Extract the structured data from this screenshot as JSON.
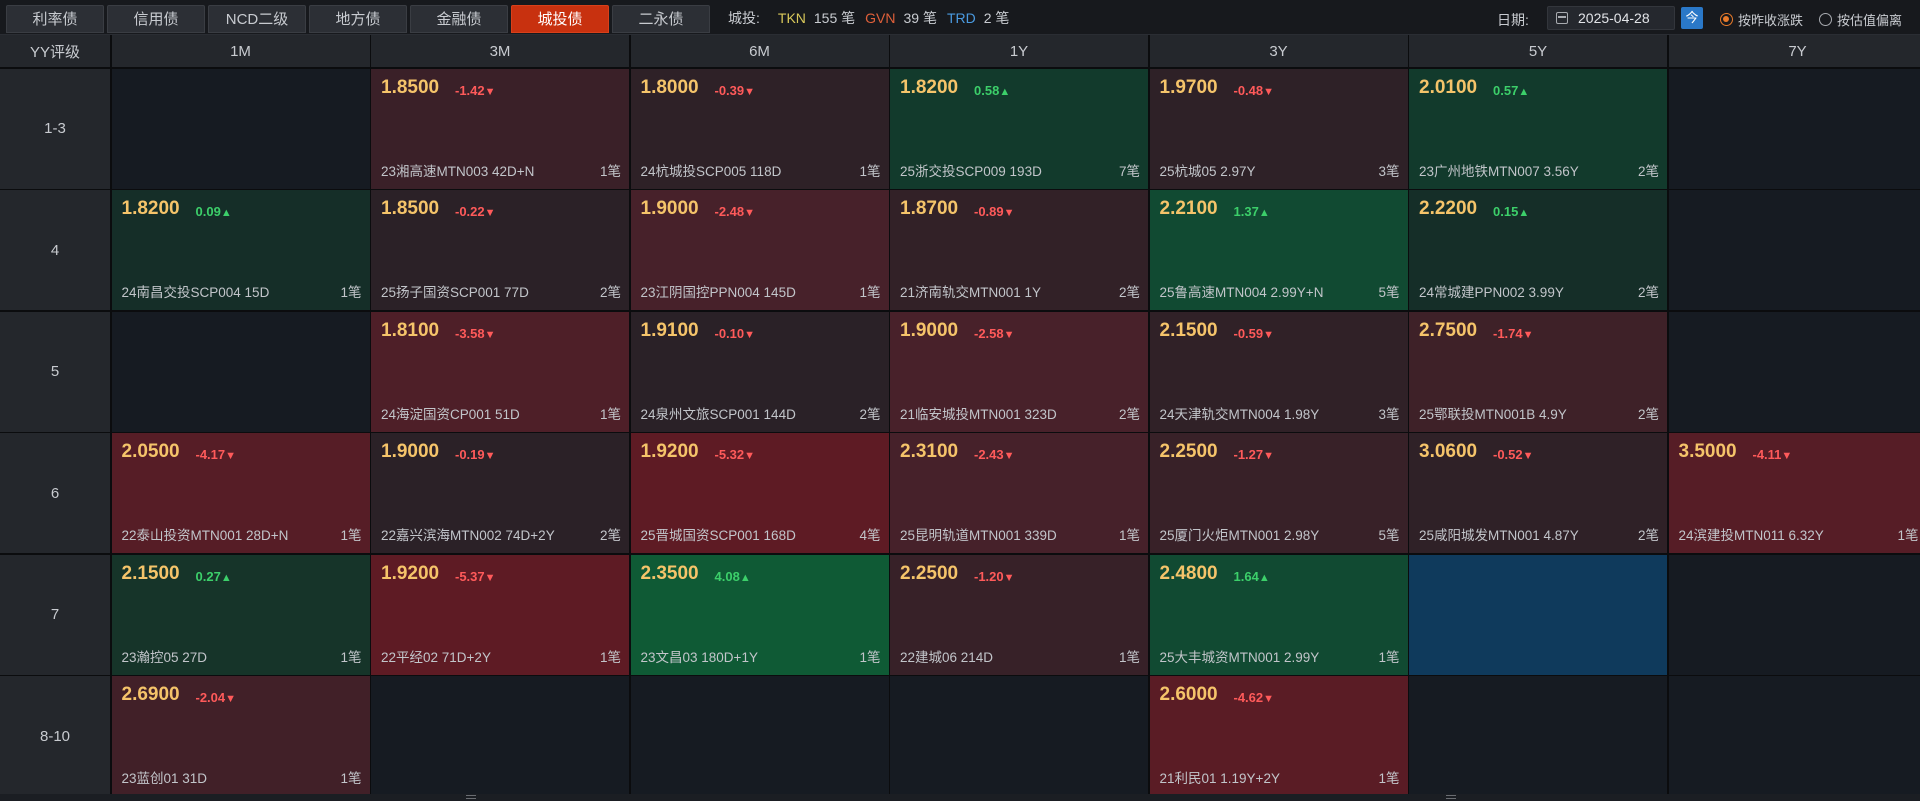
{
  "tabs": [
    "利率债",
    "信用债",
    "NCD二级",
    "地方债",
    "金融债",
    "城投债",
    "二永债"
  ],
  "active_tab": "城投债",
  "stats": {
    "label": "城投:",
    "tkn_key": "TKN",
    "tkn_value": "155 笔",
    "gvn_key": "GVN",
    "gvn_value": "39 笔",
    "trd_key": "TRD",
    "trd_value": "2 笔"
  },
  "date": {
    "label": "日期:",
    "value": "2025-04-28",
    "today_label": "今"
  },
  "radios": [
    {
      "label": "按昨收涨跌",
      "checked": true
    },
    {
      "label": "按估值偏离",
      "checked": false
    }
  ],
  "colors": {
    "active_tab": "#c8310f",
    "yield": "#f5c46a",
    "up": "#3ccf6a",
    "down": "#ff5a5a"
  },
  "grid": {
    "corner": "YY评级",
    "columns": [
      "1M",
      "3M",
      "6M",
      "1Y",
      "3Y",
      "5Y",
      "7Y"
    ],
    "rows": [
      {
        "rating": "1-3",
        "cells": [
          null,
          {
            "yield": "1.8500",
            "change": "-1.42",
            "dir": "down",
            "bond": "23湘高速MTN003 42D+N",
            "count": "1笔",
            "bg": "#3a2028"
          },
          {
            "yield": "1.8000",
            "change": "-0.39",
            "dir": "down",
            "bond": "24杭城投SCP005 118D",
            "count": "1笔",
            "bg": "#2e2127"
          },
          {
            "yield": "1.8200",
            "change": "0.58",
            "dir": "up",
            "bond": "25浙交投SCP009 193D",
            "count": "7笔",
            "bg": "#123a2c"
          },
          {
            "yield": "1.9700",
            "change": "-0.48",
            "dir": "down",
            "bond": "25杭城05 2.97Y",
            "count": "3笔",
            "bg": "#2e2127"
          },
          {
            "yield": "2.0100",
            "change": "0.57",
            "dir": "up",
            "bond": "23广州地铁MTN007 3.56Y",
            "count": "2笔",
            "bg": "#123a2c"
          },
          null
        ]
      },
      {
        "rating": "4",
        "cells": [
          {
            "yield": "1.8200",
            "change": "0.09",
            "dir": "up",
            "bond": "24南昌交投SCP004 15D",
            "count": "1笔",
            "bg": "#152e28"
          },
          {
            "yield": "1.8500",
            "change": "-0.22",
            "dir": "down",
            "bond": "25扬子国资SCP001 77D",
            "count": "2笔",
            "bg": "#2b2127"
          },
          {
            "yield": "1.9000",
            "change": "-2.48",
            "dir": "down",
            "bond": "23江阴国控PPN004 145D",
            "count": "1笔",
            "bg": "#47212a"
          },
          {
            "yield": "1.8700",
            "change": "-0.89",
            "dir": "down",
            "bond": "21济南轨交MTN001 1Y",
            "count": "2笔",
            "bg": "#322127"
          },
          {
            "yield": "2.2100",
            "change": "1.37",
            "dir": "up",
            "bond": "25鲁高速MTN004 2.99Y+N",
            "count": "5笔",
            "bg": "#114a32"
          },
          {
            "yield": "2.2200",
            "change": "0.15",
            "dir": "up",
            "bond": "24常城建PPN002 3.99Y",
            "count": "2笔",
            "bg": "#152e28"
          },
          null
        ]
      },
      {
        "rating": "5",
        "cells": [
          null,
          {
            "yield": "1.8100",
            "change": "-3.58",
            "dir": "down",
            "bond": "24海淀国资CP001 51D",
            "count": "1笔",
            "bg": "#4e1f28"
          },
          {
            "yield": "1.9100",
            "change": "-0.10",
            "dir": "down",
            "bond": "24泉州文旅SCP001 144D",
            "count": "2笔",
            "bg": "#2a2127"
          },
          {
            "yield": "1.9000",
            "change": "-2.58",
            "dir": "down",
            "bond": "21临安城投MTN001 323D",
            "count": "2笔",
            "bg": "#48212a"
          },
          {
            "yield": "2.1500",
            "change": "-0.59",
            "dir": "down",
            "bond": "24天津轨交MTN004 1.98Y",
            "count": "3笔",
            "bg": "#302127"
          },
          {
            "yield": "2.7500",
            "change": "-1.74",
            "dir": "down",
            "bond": "25鄂联投MTN001B 4.9Y",
            "count": "2笔",
            "bg": "#3e2128"
          },
          null
        ]
      },
      {
        "rating": "6",
        "cells": [
          {
            "yield": "2.0500",
            "change": "-4.17",
            "dir": "down",
            "bond": "22泰山投资MTN001 28D+N",
            "count": "1笔",
            "bg": "#561d26"
          },
          {
            "yield": "1.9000",
            "change": "-0.19",
            "dir": "down",
            "bond": "22嘉兴滨海MTN002 74D+2Y",
            "count": "2笔",
            "bg": "#2b2127"
          },
          {
            "yield": "1.9200",
            "change": "-5.32",
            "dir": "down",
            "bond": "25晋城国资SCP001 168D",
            "count": "4笔",
            "bg": "#5e1b24"
          },
          {
            "yield": "2.3100",
            "change": "-2.43",
            "dir": "down",
            "bond": "25昆明轨道MTN001 339D",
            "count": "1笔",
            "bg": "#46212a"
          },
          {
            "yield": "2.2500",
            "change": "-1.27",
            "dir": "down",
            "bond": "25厦门火炬MTN001 2.98Y",
            "count": "5笔",
            "bg": "#382128"
          },
          {
            "yield": "3.0600",
            "change": "-0.52",
            "dir": "down",
            "bond": "25咸阳城发MTN001 4.87Y",
            "count": "2笔",
            "bg": "#2f2127"
          },
          {
            "yield": "3.5000",
            "change": "-4.11",
            "dir": "down",
            "bond": "24滨建投MTN011 6.32Y",
            "count": "1笔",
            "bg": "#561d26"
          }
        ]
      },
      {
        "rating": "7",
        "cells": [
          {
            "yield": "2.1500",
            "change": "0.27",
            "dir": "up",
            "bond": "23瀚控05 27D",
            "count": "1笔",
            "bg": "#163429"
          },
          {
            "yield": "1.9200",
            "change": "-5.37",
            "dir": "down",
            "bond": "22平经02 71D+2Y",
            "count": "1笔",
            "bg": "#5e1b24"
          },
          {
            "yield": "2.3500",
            "change": "4.08",
            "dir": "up",
            "bond": "23文昌03 180D+1Y",
            "count": "1笔",
            "bg": "#0f5a35"
          },
          {
            "yield": "2.2500",
            "change": "-1.20",
            "dir": "down",
            "bond": "22建城06 214D",
            "count": "1笔",
            "bg": "#372128"
          },
          {
            "yield": "2.4800",
            "change": "1.64",
            "dir": "up",
            "bond": "25大丰城资MTN001 2.99Y",
            "count": "1笔",
            "bg": "#114a32"
          },
          "blue",
          null
        ]
      },
      {
        "rating": "8-10",
        "cells": [
          {
            "yield": "2.6900",
            "change": "-2.04",
            "dir": "down",
            "bond": "23蓝创01 31D",
            "count": "1笔",
            "bg": "#412028"
          },
          null,
          null,
          null,
          {
            "yield": "2.6000",
            "change": "-4.62",
            "dir": "down",
            "bond": "21利民01 1.19Y+2Y",
            "count": "1笔",
            "bg": "#5a1c25"
          },
          null,
          null
        ]
      }
    ]
  }
}
